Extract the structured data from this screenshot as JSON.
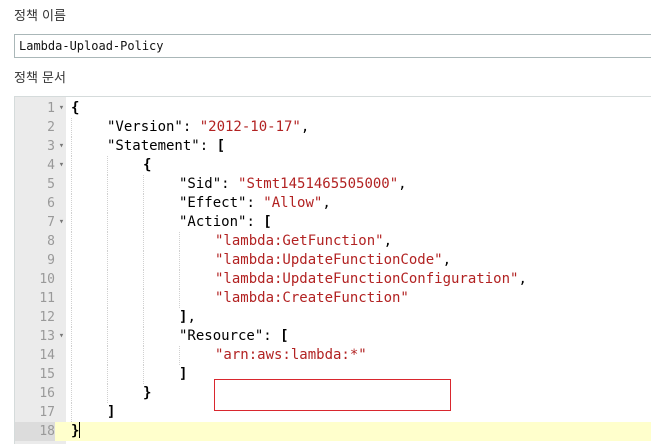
{
  "policy_name": {
    "label": "정책 이름",
    "value": "Lambda-Upload-Policy"
  },
  "policy_document": {
    "label": "정책 문서",
    "active_line": 18,
    "lines": [
      {
        "n": "1",
        "fold": true
      },
      {
        "n": "2",
        "fold": false
      },
      {
        "n": "3",
        "fold": true
      },
      {
        "n": "4",
        "fold": true
      },
      {
        "n": "5",
        "fold": false
      },
      {
        "n": "6",
        "fold": false
      },
      {
        "n": "7",
        "fold": true
      },
      {
        "n": "8",
        "fold": false
      },
      {
        "n": "9",
        "fold": false
      },
      {
        "n": "10",
        "fold": false
      },
      {
        "n": "11",
        "fold": false
      },
      {
        "n": "12",
        "fold": false
      },
      {
        "n": "13",
        "fold": true
      },
      {
        "n": "14",
        "fold": false
      },
      {
        "n": "15",
        "fold": false
      },
      {
        "n": "16",
        "fold": false
      },
      {
        "n": "17",
        "fold": false
      },
      {
        "n": "18",
        "fold": false
      }
    ],
    "tokens": {
      "version_key": "\"Version\"",
      "version_val": "\"2012-10-17\"",
      "statement_key": "\"Statement\"",
      "sid_key": "\"Sid\"",
      "sid_val": "\"Stmt1451465505000\"",
      "effect_key": "\"Effect\"",
      "effect_val": "\"Allow\"",
      "action_key": "\"Action\"",
      "action_1": "\"lambda:GetFunction\"",
      "action_2": "\"lambda:UpdateFunctionCode\"",
      "action_3": "\"lambda:UpdateFunctionConfiguration\"",
      "action_4": "\"lambda:CreateFunction\"",
      "resource_key": "\"Resource\"",
      "resource_val": "\"arn:aws:lambda:*\""
    }
  }
}
